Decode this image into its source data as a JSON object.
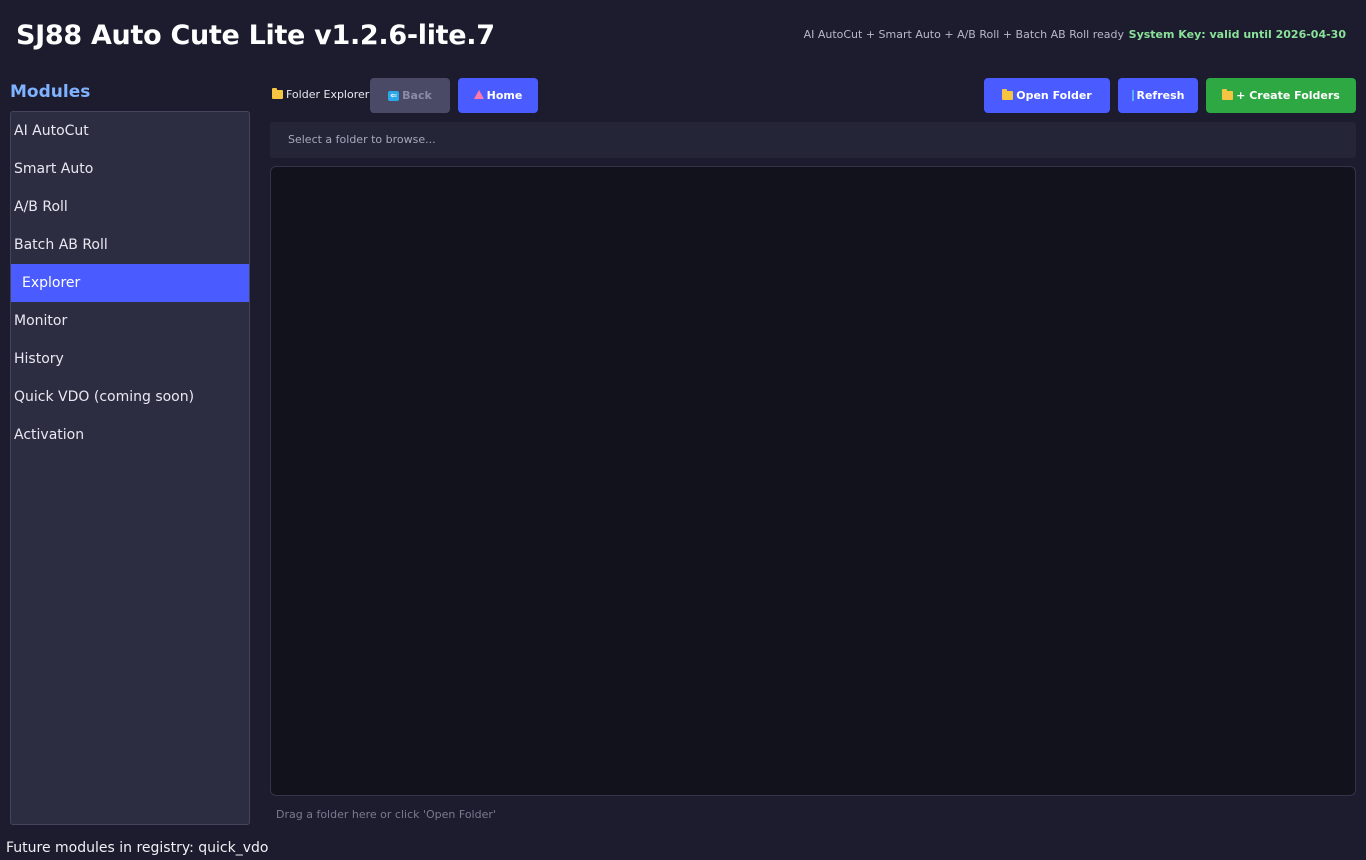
{
  "header": {
    "title": "SJ88 Auto Cute Lite v1.2.6-lite.7",
    "ready_status": "AI AutoCut + Smart Auto + A/B Roll + Batch AB Roll ready",
    "system_key": "System Key: valid until 2026-04-30",
    "system_key_color": "#8ae29a"
  },
  "sidebar": {
    "heading": "Modules",
    "items": [
      {
        "label": "AI AutoCut"
      },
      {
        "label": "Smart Auto"
      },
      {
        "label": "A/B Roll"
      },
      {
        "label": "Batch AB Roll"
      },
      {
        "label": "Explorer",
        "active": true
      },
      {
        "label": "Monitor"
      },
      {
        "label": "History"
      },
      {
        "label": "Quick VDO (coming soon)"
      },
      {
        "label": "Activation"
      }
    ],
    "footer": "Future modules in registry: quick_vdo"
  },
  "toolbar": {
    "label": "Folder Explorer",
    "back_label": "Back",
    "home_label": "Home",
    "open_folder_label": "Open Folder",
    "refresh_label": "Refresh",
    "create_folders_label": "+ Create Folders"
  },
  "explorer": {
    "path_text": "Select a folder to browse...",
    "hint": "Drag a folder here or click 'Open Folder'"
  },
  "colors": {
    "accent": "#4a5cff",
    "success": "#2da843",
    "background": "#1c1c2e"
  }
}
